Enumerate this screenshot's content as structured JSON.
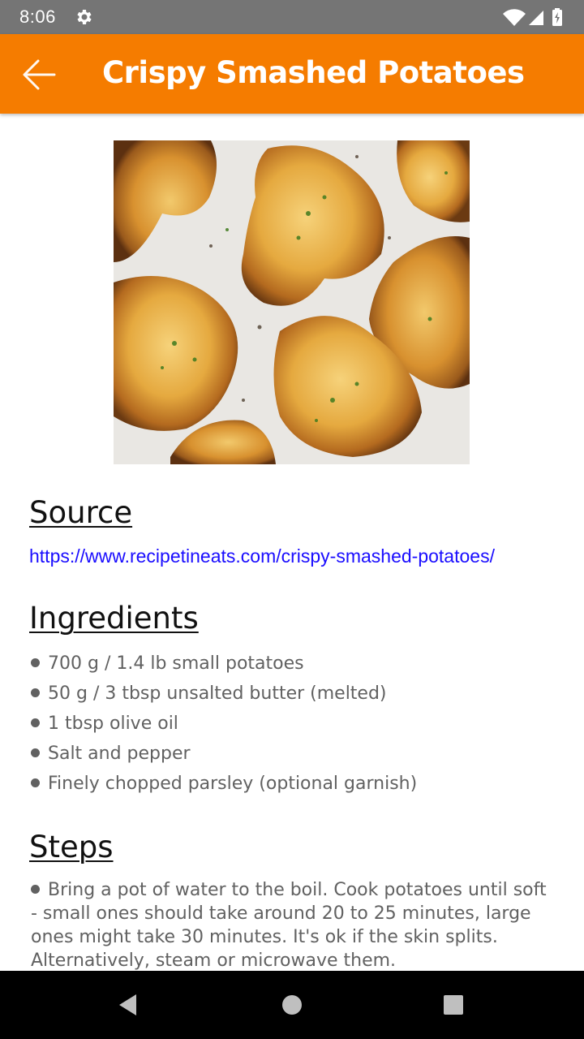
{
  "status_bar": {
    "time": "8:06",
    "icons": [
      "gear-icon",
      "wifi-icon",
      "signal-icon",
      "battery-icon"
    ]
  },
  "app_bar": {
    "title": "Crispy Smashed Potatoes",
    "back_icon": "arrow-left-icon",
    "background": "#f57c00"
  },
  "recipe": {
    "image": "crispy-smashed-potatoes-photo",
    "source": {
      "heading": "Source",
      "url": "https://www.recipetineats.com/crispy-smashed-potatoes/"
    },
    "ingredients": {
      "heading": "Ingredients",
      "items": [
        "700 g / 1.4 lb small potatoes",
        "50 g / 3 tbsp unsalted butter (melted)",
        "1 tbsp olive oil",
        "Salt and pepper",
        "Finely chopped parsley (optional garnish)"
      ]
    },
    "steps": {
      "heading": "Steps",
      "items": [
        "Bring a pot of water to the boil. Cook potatoes until soft - small ones should take around 20 to 25 minutes, large ones might take 30 minutes. It's ok if the skin splits. Alternatively, steam or microwave them."
      ]
    }
  },
  "nav_bar": {
    "buttons": [
      "back-triangle-icon",
      "home-circle-icon",
      "recents-square-icon"
    ]
  },
  "colors": {
    "accent": "#f57c00",
    "link": "#1a0dff",
    "body_text": "#616161",
    "status_bar": "#757575"
  }
}
